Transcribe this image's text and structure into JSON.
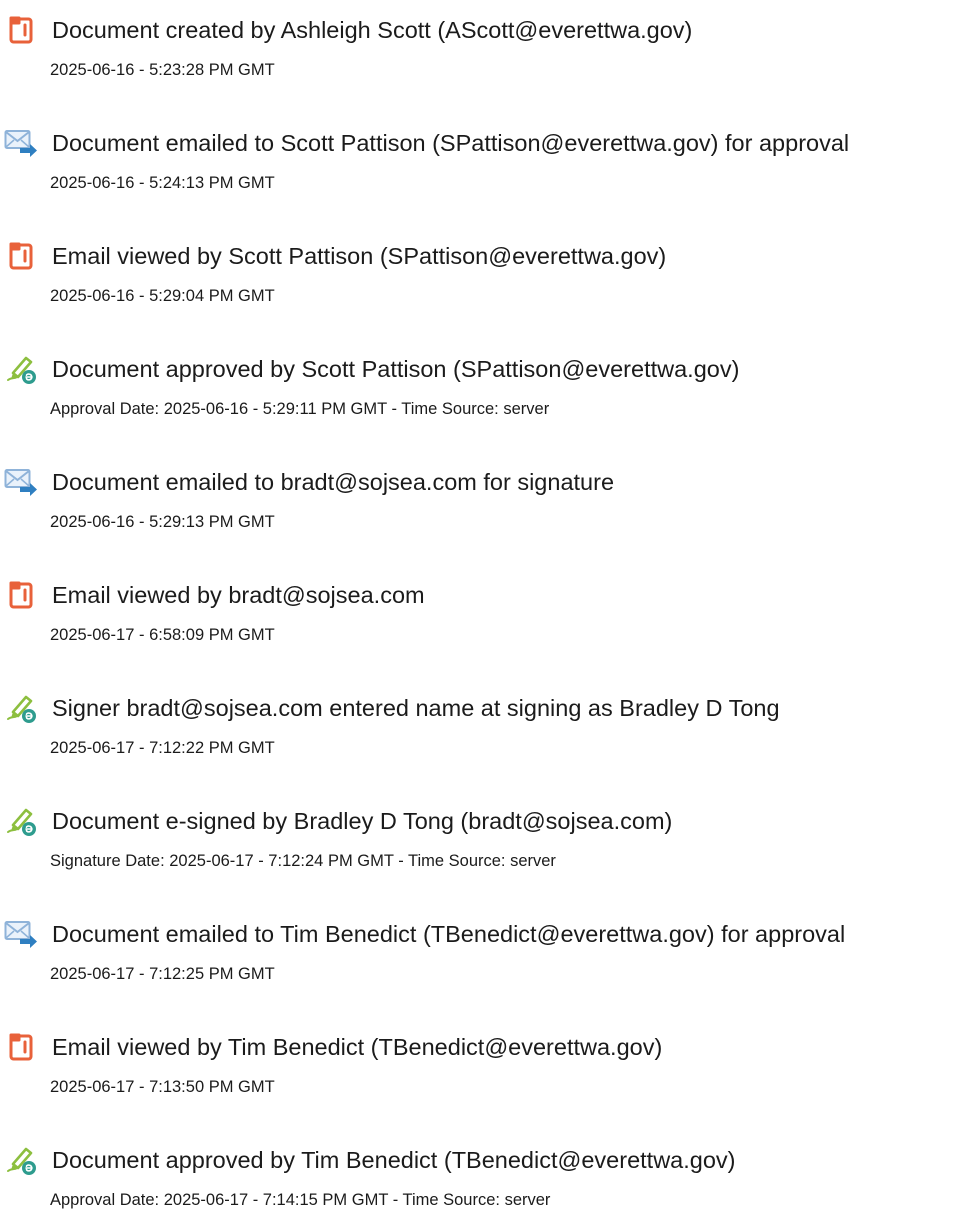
{
  "entries": [
    {
      "icon": "document-icon",
      "title": "Document created by Ashleigh Scott (AScott@everettwa.gov)",
      "detail": "2025-06-16 - 5:23:28 PM GMT"
    },
    {
      "icon": "email-sent-icon",
      "title": "Document emailed to Scott Pattison (SPattison@everettwa.gov) for approval",
      "detail": "2025-06-16 - 5:24:13 PM GMT"
    },
    {
      "icon": "document-icon",
      "title": "Email viewed by Scott Pattison (SPattison@everettwa.gov)",
      "detail": "2025-06-16 - 5:29:04 PM GMT"
    },
    {
      "icon": "signature-pen-icon",
      "title": "Document approved by Scott Pattison (SPattison@everettwa.gov)",
      "detail": "Approval Date: 2025-06-16 - 5:29:11 PM GMT - Time Source: server"
    },
    {
      "icon": "email-sent-icon",
      "title": "Document emailed to bradt@sojsea.com for signature",
      "detail": "2025-06-16 - 5:29:13 PM GMT"
    },
    {
      "icon": "document-icon",
      "title": "Email viewed by bradt@sojsea.com",
      "detail": "2025-06-17 - 6:58:09 PM GMT"
    },
    {
      "icon": "signature-pen-icon",
      "title": "Signer bradt@sojsea.com entered name at signing as Bradley D Tong",
      "detail": "2025-06-17 - 7:12:22 PM GMT"
    },
    {
      "icon": "signature-pen-icon",
      "title": "Document e-signed by Bradley D Tong (bradt@sojsea.com)",
      "detail": "Signature Date: 2025-06-17 - 7:12:24 PM GMT - Time Source: server"
    },
    {
      "icon": "email-sent-icon",
      "title": "Document emailed to Tim Benedict (TBenedict@everettwa.gov) for approval",
      "detail": "2025-06-17 - 7:12:25 PM GMT"
    },
    {
      "icon": "document-icon",
      "title": "Email viewed by Tim Benedict (TBenedict@everettwa.gov)",
      "detail": "2025-06-17 - 7:13:50 PM GMT"
    },
    {
      "icon": "signature-pen-icon",
      "title": "Document approved by Tim Benedict (TBenedict@everettwa.gov)",
      "detail": "Approval Date: 2025-06-17 - 7:14:15 PM GMT - Time Source: server"
    }
  ],
  "colors": {
    "document_icon": "#e8613a",
    "email_icon": "#8fb3d9",
    "email_arrow": "#2f7fc1",
    "pen_icon": "#8dbf3f",
    "pen_badge": "#2e9c8e"
  }
}
